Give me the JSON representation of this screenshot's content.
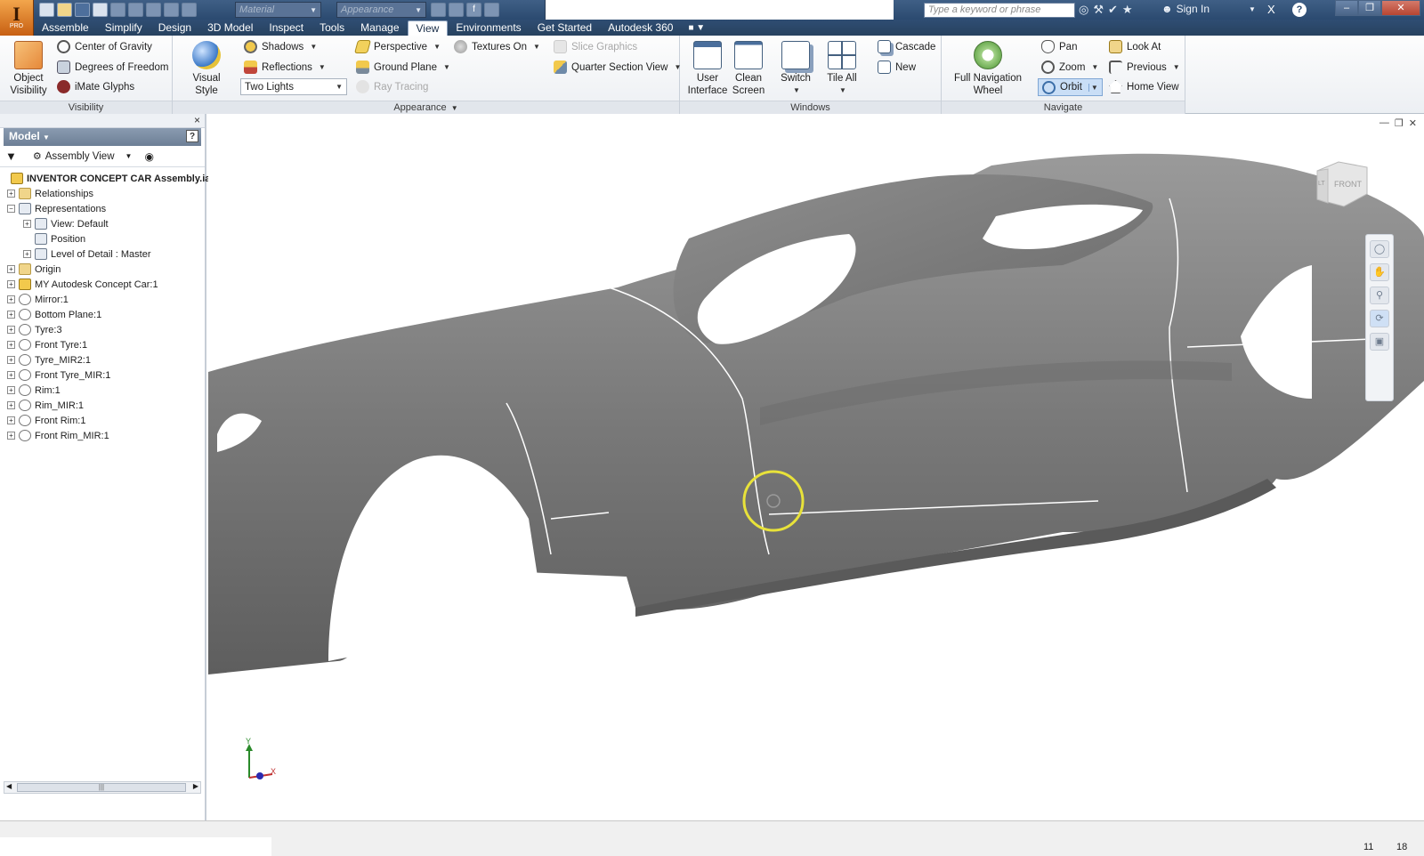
{
  "app": {
    "logo": "I",
    "edition": "PRO"
  },
  "quick_access": {
    "material_placeholder": "Material",
    "appearance_placeholder": "Appearance"
  },
  "search": {
    "placeholder": "Type a keyword or phrase"
  },
  "account": {
    "sign_in": "Sign In"
  },
  "tabs": [
    {
      "label": "Assemble"
    },
    {
      "label": "Simplify"
    },
    {
      "label": "Design"
    },
    {
      "label": "3D Model"
    },
    {
      "label": "Inspect"
    },
    {
      "label": "Tools"
    },
    {
      "label": "Manage"
    },
    {
      "label": "View",
      "active": true
    },
    {
      "label": "Environments"
    },
    {
      "label": "Get Started"
    },
    {
      "label": "Autodesk 360"
    }
  ],
  "ribbon": {
    "visibility": {
      "label": "Visibility",
      "object_visibility": "Object\nVisibility",
      "center_of_gravity": "Center of Gravity",
      "degrees_of_freedom": "Degrees of Freedom",
      "imate_glyphs": "iMate Glyphs"
    },
    "appearance": {
      "label": "Appearance",
      "visual_style": "Visual Style",
      "shadows": "Shadows",
      "reflections": "Reflections",
      "lighting": "Two Lights",
      "perspective": "Perspective",
      "ground_plane": "Ground Plane",
      "ray_tracing": "Ray Tracing",
      "textures_on": "Textures On",
      "slice_graphics": "Slice Graphics",
      "quarter_section_view": "Quarter Section View"
    },
    "windows": {
      "label": "Windows",
      "user_interface": "User\nInterface",
      "clean_screen": "Clean\nScreen",
      "switch": "Switch",
      "tile_all": "Tile All",
      "cascade": "Cascade",
      "new": "New"
    },
    "navigate": {
      "label": "Navigate",
      "full_nav_wheel": "Full Navigation\nWheel",
      "pan": "Pan",
      "zoom": "Zoom",
      "orbit": "Orbit",
      "look_at": "Look At",
      "previous": "Previous",
      "home_view": "Home View"
    }
  },
  "browser": {
    "title": "Model",
    "view_mode": "Assembly View",
    "root": "INVENTOR CONCEPT CAR Assembly.iam",
    "items": [
      {
        "label": "Relationships",
        "icon": "folder",
        "level": 0
      },
      {
        "label": "Representations",
        "icon": "rep",
        "level": 0,
        "expanded": true
      },
      {
        "label": "View: Default",
        "icon": "rep",
        "level": 1
      },
      {
        "label": "Position",
        "icon": "rep",
        "level": 1,
        "leaf": true
      },
      {
        "label": "Level of Detail : Master",
        "icon": "rep",
        "level": 1
      },
      {
        "label": "Origin",
        "icon": "folder",
        "level": 0
      },
      {
        "label": "MY Autodesk Concept Car:1",
        "icon": "asm",
        "level": 0
      },
      {
        "label": "Mirror:1",
        "icon": "part",
        "level": 0
      },
      {
        "label": "Bottom Plane:1",
        "icon": "part",
        "level": 0
      },
      {
        "label": "Tyre:3",
        "icon": "part",
        "level": 0
      },
      {
        "label": "Front Tyre:1",
        "icon": "part",
        "level": 0
      },
      {
        "label": "Tyre_MIR2:1",
        "icon": "part",
        "level": 0
      },
      {
        "label": "Front Tyre_MIR:1",
        "icon": "part",
        "level": 0
      },
      {
        "label": "Rim:1",
        "icon": "part",
        "level": 0
      },
      {
        "label": "Rim_MIR:1",
        "icon": "part",
        "level": 0
      },
      {
        "label": "Front Rim:1",
        "icon": "part",
        "level": 0
      },
      {
        "label": "Front Rim_MIR:1",
        "icon": "part",
        "level": 0
      }
    ]
  },
  "viewport": {
    "viewcube_front": "FRONT",
    "viewcube_left": "LT",
    "axis_y": "Y",
    "axis_x": "X"
  },
  "status": {
    "n1": "11",
    "n2": "18"
  },
  "colors": {
    "highlight_ring": "#e8e23a",
    "car_body": "#8a8a8a",
    "title_bar": "#2f4d73"
  }
}
